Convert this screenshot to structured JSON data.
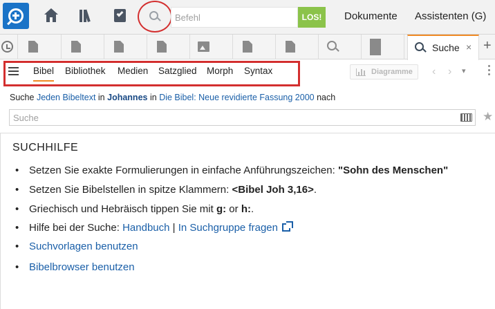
{
  "toolbar": {
    "command_placeholder": "Befehl",
    "go_label": "LOS!",
    "menu_documents": "Dokumente",
    "menu_assistants": "Assistenten (G)"
  },
  "tabs": {
    "active_label": "Suche",
    "close_glyph": "×",
    "new_tab_glyph": "+"
  },
  "panel": {
    "tabs": [
      "Bibel",
      "Bibliothek",
      "Medien",
      "Satzglied",
      "Morph",
      "Syntax"
    ],
    "diagram_label": "Diagramme",
    "prev_glyph": "‹",
    "next_glyph": "›",
    "dropdown_glyph": "▾"
  },
  "search": {
    "prefix": "Suche",
    "scope": "Jeden Bibeltext",
    "in1": "in",
    "book": "Johannes",
    "in2": "in",
    "bible": "Die Bibel: Neue revidierte Fassung 2000",
    "suffix": "nach",
    "placeholder": "Suche",
    "star_glyph": "★"
  },
  "help": {
    "title": "SUCHHILFE",
    "bullet": "•",
    "item1_text": "Setzen Sie exakte Formulierungen in einfache Anführungszeichen: ",
    "item1_example": "\"Sohn des Menschen\"",
    "item2_text": "Setzen Sie Bibelstellen in spitze Klammern: ",
    "item2_example": "<Bibel Joh 3,16>",
    "item2_end": ".",
    "item3_text": "Griechisch und Hebräisch tippen Sie mit ",
    "item3_g": "g:",
    "item3_or": " or ",
    "item3_h": "h:",
    "item3_end": ".",
    "item4_text": "Hilfe bei der Suche: ",
    "item4_link1": "Handbuch",
    "item4_sep": " | ",
    "item4_link2": "In Suchgruppe fragen",
    "item5_link": "Suchvorlagen benutzen",
    "item6_link": "Bibelbrowser benutzen"
  },
  "colors": {
    "accent_orange": "#f08a24",
    "brand_blue": "#1a73c7",
    "go_green": "#8bc34a",
    "highlight_red": "#d32f2f",
    "link_blue": "#1a5fa8"
  },
  "icons": [
    "logo-search-icon",
    "home-icon",
    "library-icon",
    "tasks-icon",
    "search-icon",
    "history-icon",
    "document-icon",
    "image-icon",
    "book-icon",
    "close-icon",
    "hamburger-icon",
    "chart-icon",
    "keyboard-icon",
    "star-icon",
    "external-link-icon"
  ]
}
